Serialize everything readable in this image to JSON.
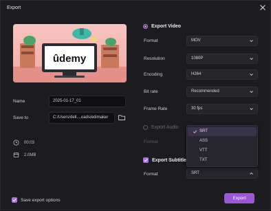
{
  "window": {
    "title": "Export"
  },
  "preview": {
    "brand_text": "ûdemy",
    "brand_color": "#a435f0"
  },
  "file": {
    "name_label": "Name",
    "name_value": "2025-01-17_01",
    "save_to_label": "Save to",
    "save_to_value": "C:/Users/dell....oads/edimaker",
    "duration": "00:03",
    "size": "2.0MB"
  },
  "export_video": {
    "heading": "Export Video",
    "selected": true,
    "rows": [
      {
        "label": "Format",
        "value": "MOV"
      },
      {
        "label": "Resolution",
        "value": "1080P"
      },
      {
        "label": "Encoding",
        "value": "H264"
      },
      {
        "label": "Bit rate",
        "value": "Recommended"
      },
      {
        "label": "Frame Rate",
        "value": "30  fps"
      }
    ]
  },
  "export_audio": {
    "heading": "Export Audio",
    "selected": false,
    "format_label": "Format"
  },
  "subtitle_dropdown": {
    "options": [
      "SRT",
      "ASS",
      "VTT",
      "TXT"
    ],
    "selected": "SRT"
  },
  "export_subtitles": {
    "heading": "Export Subtitles",
    "checked": true,
    "format_label": "Format",
    "format_value": "SRT"
  },
  "footer": {
    "save_options_label": "Save export options",
    "export_label": "Export"
  },
  "colors": {
    "accent": "#9b57d6",
    "background": "#1b1b20",
    "input_bg": "#0f0f12"
  },
  "icons": {
    "close": "close-icon",
    "folder": "folder-icon",
    "clock": "clock-icon",
    "file": "file-icon",
    "chevron": "chevron-down-icon",
    "check": "check-icon"
  }
}
